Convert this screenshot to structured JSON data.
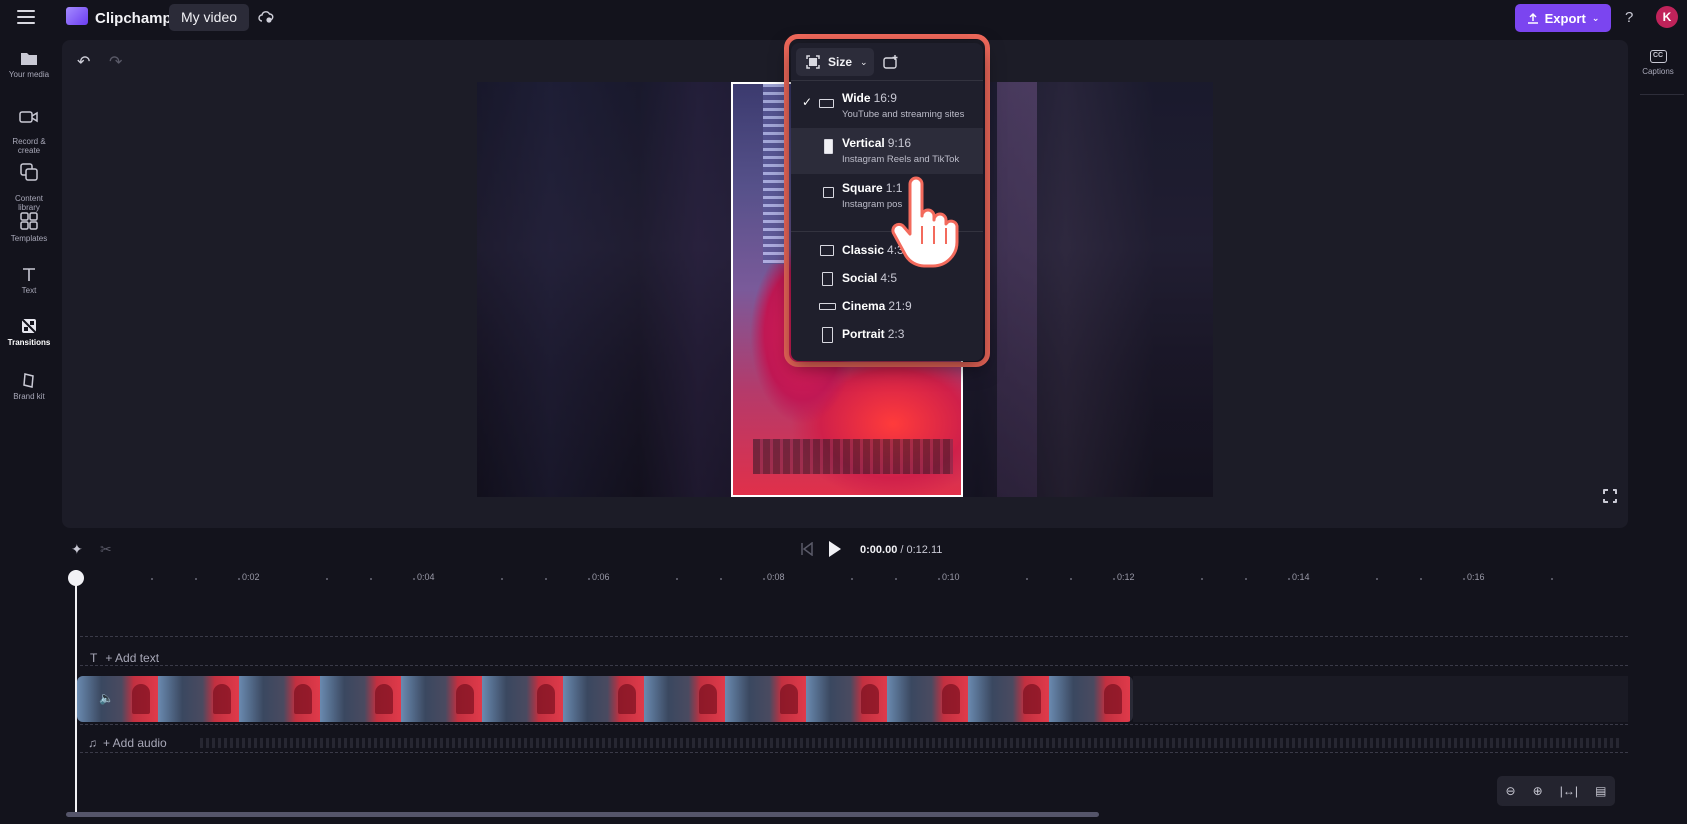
{
  "app": {
    "name": "Clipchamp",
    "project_title": "My video",
    "export_label": "Export",
    "help": "?",
    "avatar_initial": "K"
  },
  "left_nav": [
    {
      "label": "Your media",
      "icon": "folder-icon"
    },
    {
      "label": "Record &\ncreate",
      "icon": "camera-icon"
    },
    {
      "label": "Content\nlibrary",
      "icon": "library-icon"
    },
    {
      "label": "Templates",
      "icon": "templates-icon"
    },
    {
      "label": "Text",
      "icon": "text-icon"
    },
    {
      "label": "Transitions",
      "icon": "transitions-icon",
      "active": true
    },
    {
      "label": "Brand kit",
      "icon": "brand-kit-icon"
    }
  ],
  "right_nav": {
    "captions_label": "Captions",
    "captions_icon_text": "CC"
  },
  "size_menu": {
    "button_label": "Size",
    "items": [
      {
        "name": "Wide",
        "ratio": "16:9",
        "desc": "YouTube and streaming sites",
        "selected": true
      },
      {
        "name": "Vertical",
        "ratio": "9:16",
        "desc": "Instagram Reels and TikTok",
        "hover": true
      },
      {
        "name": "Square",
        "ratio": "1:1",
        "desc": "Instagram pos"
      }
    ],
    "more_items": [
      {
        "name": "Classic",
        "ratio": "4:3"
      },
      {
        "name": "Social",
        "ratio": "4:5"
      },
      {
        "name": "Cinema",
        "ratio": "21:9"
      },
      {
        "name": "Portrait",
        "ratio": "2:3"
      }
    ]
  },
  "player": {
    "current_time": "0:00.00",
    "separator": " / ",
    "total_time": "0:12.11"
  },
  "timeline": {
    "ruler_labels": [
      "0:02",
      "0:04",
      "0:06",
      "0:08",
      "0:10",
      "0:12",
      "0:14",
      "0:16"
    ],
    "add_text": "+ Add text",
    "add_audio": "+ Add audio",
    "clip_thumbnail_count": 13
  },
  "colors": {
    "accent": "#7b45f0",
    "highlight_outline": "#f36a5c",
    "avatar": "#c0235a",
    "background": "#13131c"
  }
}
